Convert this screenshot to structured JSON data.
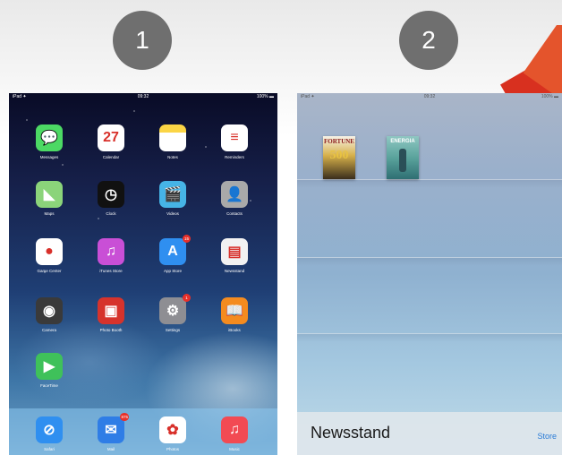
{
  "steps": [
    "1",
    "2"
  ],
  "ipad1": {
    "status": {
      "left": "iPad ✦",
      "time": "09:32",
      "battery": "100% ▬"
    },
    "apps": [
      {
        "name": "messages-app-icon",
        "label": "Messages",
        "glyph": "💬",
        "color": "#4cd964",
        "badge": ""
      },
      {
        "name": "calendar-app-icon",
        "label": "Calendar",
        "glyph": "27",
        "color": "#ffffff",
        "badge": ""
      },
      {
        "name": "notes-app-icon",
        "label": "Notes",
        "glyph": "",
        "color": "#fbd545",
        "badge": ""
      },
      {
        "name": "reminders-app-icon",
        "label": "Reminders",
        "glyph": "≡",
        "color": "#ffffff",
        "badge": ""
      },
      {
        "name": "maps-app-icon",
        "label": "Maps",
        "glyph": "◣",
        "color": "#8bd47a",
        "badge": ""
      },
      {
        "name": "clock-app-icon",
        "label": "Clock",
        "glyph": "◷",
        "color": "#111111",
        "badge": ""
      },
      {
        "name": "videos-app-icon",
        "label": "Videos",
        "glyph": "🎬",
        "color": "#46b4e6",
        "badge": ""
      },
      {
        "name": "contacts-app-icon",
        "label": "Contacts",
        "glyph": "👤",
        "color": "#a9a9a9",
        "badge": ""
      },
      {
        "name": "game-center-app-icon",
        "label": "Game Center",
        "glyph": "●",
        "color": "#ffffff",
        "badge": ""
      },
      {
        "name": "itunes-store-app-icon",
        "label": "iTunes Store",
        "glyph": "♫",
        "color": "#c94fd6",
        "badge": ""
      },
      {
        "name": "app-store-app-icon",
        "label": "App Store",
        "glyph": "A",
        "color": "#2f8ff0",
        "badge": "15"
      },
      {
        "name": "newsstand-app-icon",
        "label": "Newsstand",
        "glyph": "▤",
        "color": "#f2f2f2",
        "badge": ""
      },
      {
        "name": "camera-app-icon",
        "label": "Camera",
        "glyph": "◉",
        "color": "#3a3a3a",
        "badge": ""
      },
      {
        "name": "photo-booth-app-icon",
        "label": "Photo Booth",
        "glyph": "▣",
        "color": "#d6332c",
        "badge": ""
      },
      {
        "name": "settings-app-icon",
        "label": "Settings",
        "glyph": "⚙",
        "color": "#8e8e93",
        "badge": "1"
      },
      {
        "name": "ibooks-app-icon",
        "label": "iBooks",
        "glyph": "📖",
        "color": "#f48b1f",
        "badge": ""
      },
      {
        "name": "facetime-app-icon",
        "label": "FaceTime",
        "glyph": "▶",
        "color": "#3fc15a",
        "badge": ""
      }
    ],
    "dock": [
      {
        "name": "safari-dock-icon",
        "label": "Safari",
        "glyph": "⊘",
        "color": "#2f8ff0",
        "badge": ""
      },
      {
        "name": "mail-dock-icon",
        "label": "Mail",
        "glyph": "✉",
        "color": "#2f7de6",
        "badge": "875"
      },
      {
        "name": "photos-dock-icon",
        "label": "Photos",
        "glyph": "✿",
        "color": "#ffffff",
        "badge": ""
      },
      {
        "name": "music-dock-icon",
        "label": "Music",
        "glyph": "♫",
        "color": "#f24a53",
        "badge": ""
      }
    ]
  },
  "ipad2": {
    "status": {
      "left": "iPad ✦",
      "time": "09:32",
      "battery": "100% ▬"
    },
    "magazines": [
      {
        "title": "FORTUNE",
        "number": "500"
      },
      {
        "title": "ENERGIA"
      }
    ],
    "title": "Newsstand",
    "store_label": "Store"
  }
}
